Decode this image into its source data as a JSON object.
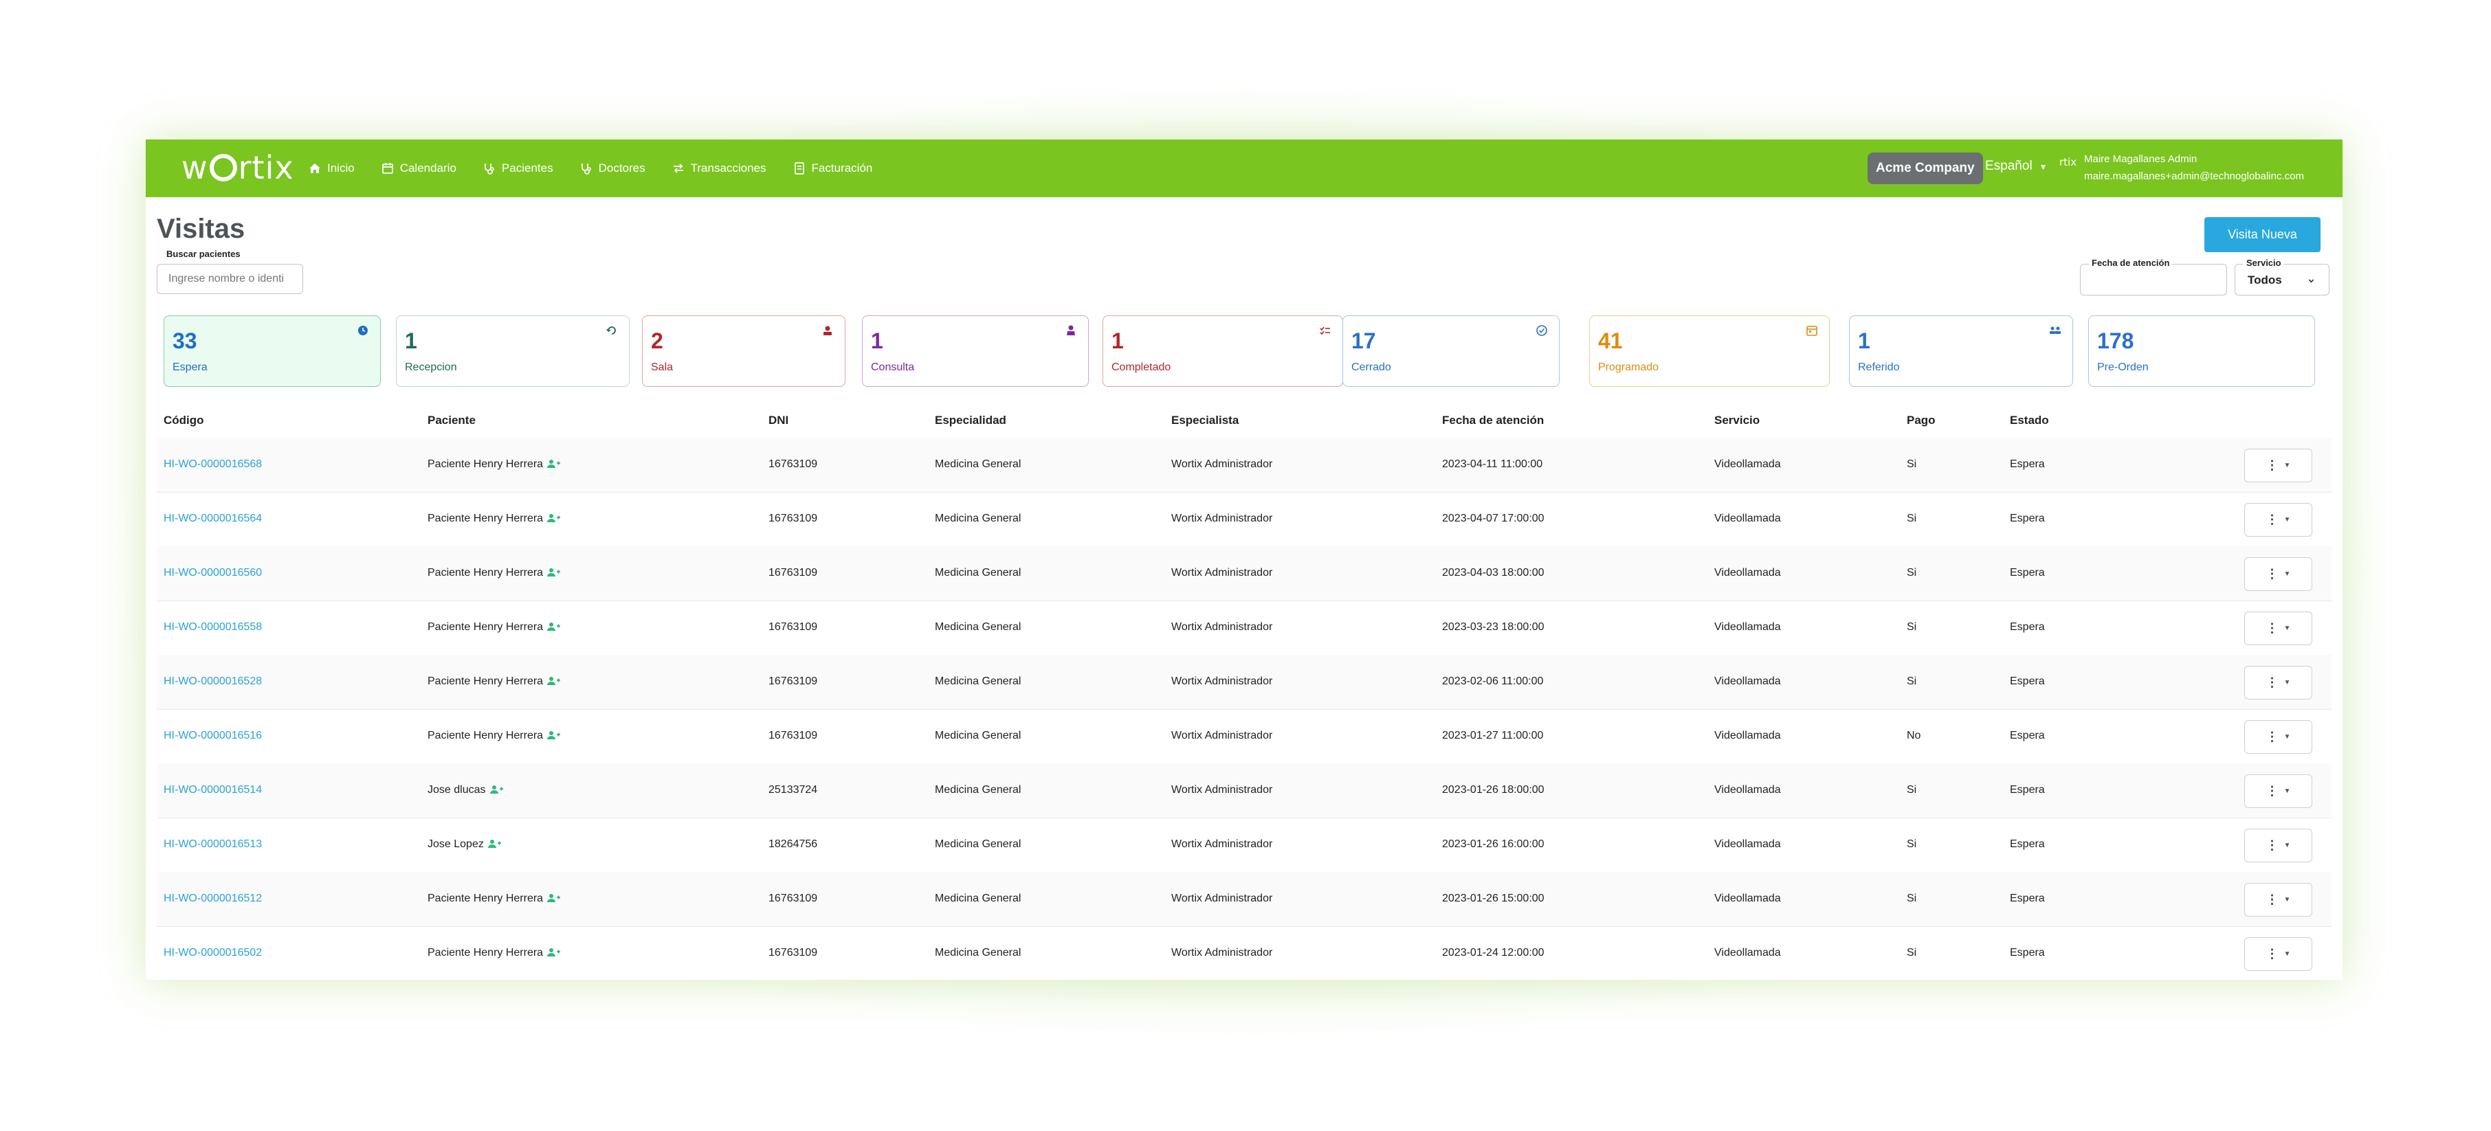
{
  "brand": {
    "logo_text_left": "w",
    "logo_text_right": "rtix"
  },
  "nav": [
    {
      "label": "Inicio",
      "icon": "home-icon"
    },
    {
      "label": "Calendario",
      "icon": "calendar-icon"
    },
    {
      "label": "Pacientes",
      "icon": "stethoscope-icon"
    },
    {
      "label": "Doctores",
      "icon": "stethoscope-icon"
    },
    {
      "label": "Transacciones",
      "icon": "swap-icon"
    },
    {
      "label": "Facturación",
      "icon": "invoice-icon"
    }
  ],
  "header": {
    "company": "Acme Company",
    "language": "Español",
    "avatar_text": "rtix",
    "user_name": "Maire Magallanes Admin",
    "user_email": "maire.magallanes+admin@technoglobalinc.com"
  },
  "page": {
    "title": "Visitas",
    "new_visit_button": "Visita Nueva",
    "search_label": "Buscar pacientes",
    "search_placeholder": "Ingrese nombre o identi",
    "date_label": "Fecha de atención",
    "service_label": "Servicio",
    "service_value": "Todos"
  },
  "colors": {
    "accent_green": "#7ac520",
    "link_blue": "#2aa2db",
    "button_blue": "#29a8df"
  },
  "status_cards": [
    {
      "count": "33",
      "label": "Espera",
      "color": "#1f6fc2",
      "border": "#7fd0a0",
      "bg": "#eafbf1",
      "icon": "clock-icon"
    },
    {
      "count": "1",
      "label": "Recepcion",
      "color": "#1d6b57",
      "border": "#b7d9d0",
      "bg": "#ffffff",
      "icon": "refresh-icon"
    },
    {
      "count": "2",
      "label": "Sala",
      "color": "#b0272a",
      "border": "#e3a3a3",
      "bg": "#ffffff",
      "icon": "room-icon"
    },
    {
      "count": "1",
      "label": "Consulta",
      "color": "#7a2aa0",
      "border": "#c9a6dc",
      "bg": "#ffffff",
      "icon": "doctor-icon"
    },
    {
      "count": "1",
      "label": "Completado",
      "color": "#b0272a",
      "border": "#e3a3a3",
      "bg": "#ffffff",
      "icon": "checklist-icon"
    },
    {
      "count": "17",
      "label": "Cerrado",
      "color": "#2b6fc9",
      "border": "#a9c4ea",
      "bg": "#ffffff",
      "icon": "check-circle-icon"
    },
    {
      "count": "41",
      "label": "Programado",
      "color": "#e08a12",
      "border": "#f0cc8e",
      "bg": "#ffffff",
      "icon": "calendar-icon"
    },
    {
      "count": "1",
      "label": "Referido",
      "color": "#2b6fc9",
      "border": "#a9c4ea",
      "bg": "#ffffff",
      "icon": "users-icon"
    },
    {
      "count": "178",
      "label": "Pre-Orden",
      "color": "#2b6fc9",
      "border": "#a9c4ea",
      "bg": "#ffffff",
      "icon": ""
    }
  ],
  "table": {
    "columns": [
      "Código",
      "Paciente",
      "DNI",
      "Especialidad",
      "Especialista",
      "Fecha de atención",
      "Servicio",
      "Pago",
      "Estado"
    ],
    "rows": [
      {
        "code": "HI-WO-0000016568",
        "patient": "Paciente Henry Herrera",
        "dni": "16763109",
        "specialty": "Medicina General",
        "specialist": "Wortix Administrador",
        "date": "2023-04-11 11:00:00",
        "service": "Videollamada",
        "payment": "Si",
        "status": "Espera"
      },
      {
        "code": "HI-WO-0000016564",
        "patient": "Paciente Henry Herrera",
        "dni": "16763109",
        "specialty": "Medicina General",
        "specialist": "Wortix Administrador",
        "date": "2023-04-07 17:00:00",
        "service": "Videollamada",
        "payment": "Si",
        "status": "Espera"
      },
      {
        "code": "HI-WO-0000016560",
        "patient": "Paciente Henry Herrera",
        "dni": "16763109",
        "specialty": "Medicina General",
        "specialist": "Wortix Administrador",
        "date": "2023-04-03 18:00:00",
        "service": "Videollamada",
        "payment": "Si",
        "status": "Espera"
      },
      {
        "code": "HI-WO-0000016558",
        "patient": "Paciente Henry Herrera",
        "dni": "16763109",
        "specialty": "Medicina General",
        "specialist": "Wortix Administrador",
        "date": "2023-03-23 18:00:00",
        "service": "Videollamada",
        "payment": "Si",
        "status": "Espera"
      },
      {
        "code": "HI-WO-0000016528",
        "patient": "Paciente Henry Herrera",
        "dni": "16763109",
        "specialty": "Medicina General",
        "specialist": "Wortix Administrador",
        "date": "2023-02-06 11:00:00",
        "service": "Videollamada",
        "payment": "Si",
        "status": "Espera"
      },
      {
        "code": "HI-WO-0000016516",
        "patient": "Paciente Henry Herrera",
        "dni": "16763109",
        "specialty": "Medicina General",
        "specialist": "Wortix Administrador",
        "date": "2023-01-27 11:00:00",
        "service": "Videollamada",
        "payment": "No",
        "status": "Espera"
      },
      {
        "code": "HI-WO-0000016514",
        "patient": "Jose dlucas",
        "dni": "25133724",
        "specialty": "Medicina General",
        "specialist": "Wortix Administrador",
        "date": "2023-01-26 18:00:00",
        "service": "Videollamada",
        "payment": "Si",
        "status": "Espera"
      },
      {
        "code": "HI-WO-0000016513",
        "patient": "Jose Lopez",
        "dni": "18264756",
        "specialty": "Medicina General",
        "specialist": "Wortix Administrador",
        "date": "2023-01-26 16:00:00",
        "service": "Videollamada",
        "payment": "Si",
        "status": "Espera"
      },
      {
        "code": "HI-WO-0000016512",
        "patient": "Paciente Henry Herrera",
        "dni": "16763109",
        "specialty": "Medicina General",
        "specialist": "Wortix Administrador",
        "date": "2023-01-26 15:00:00",
        "service": "Videollamada",
        "payment": "Si",
        "status": "Espera"
      },
      {
        "code": "HI-WO-0000016502",
        "patient": "Paciente Henry Herrera",
        "dni": "16763109",
        "specialty": "Medicina General",
        "specialist": "Wortix Administrador",
        "date": "2023-01-24 12:00:00",
        "service": "Videollamada",
        "payment": "Si",
        "status": "Espera"
      }
    ]
  }
}
